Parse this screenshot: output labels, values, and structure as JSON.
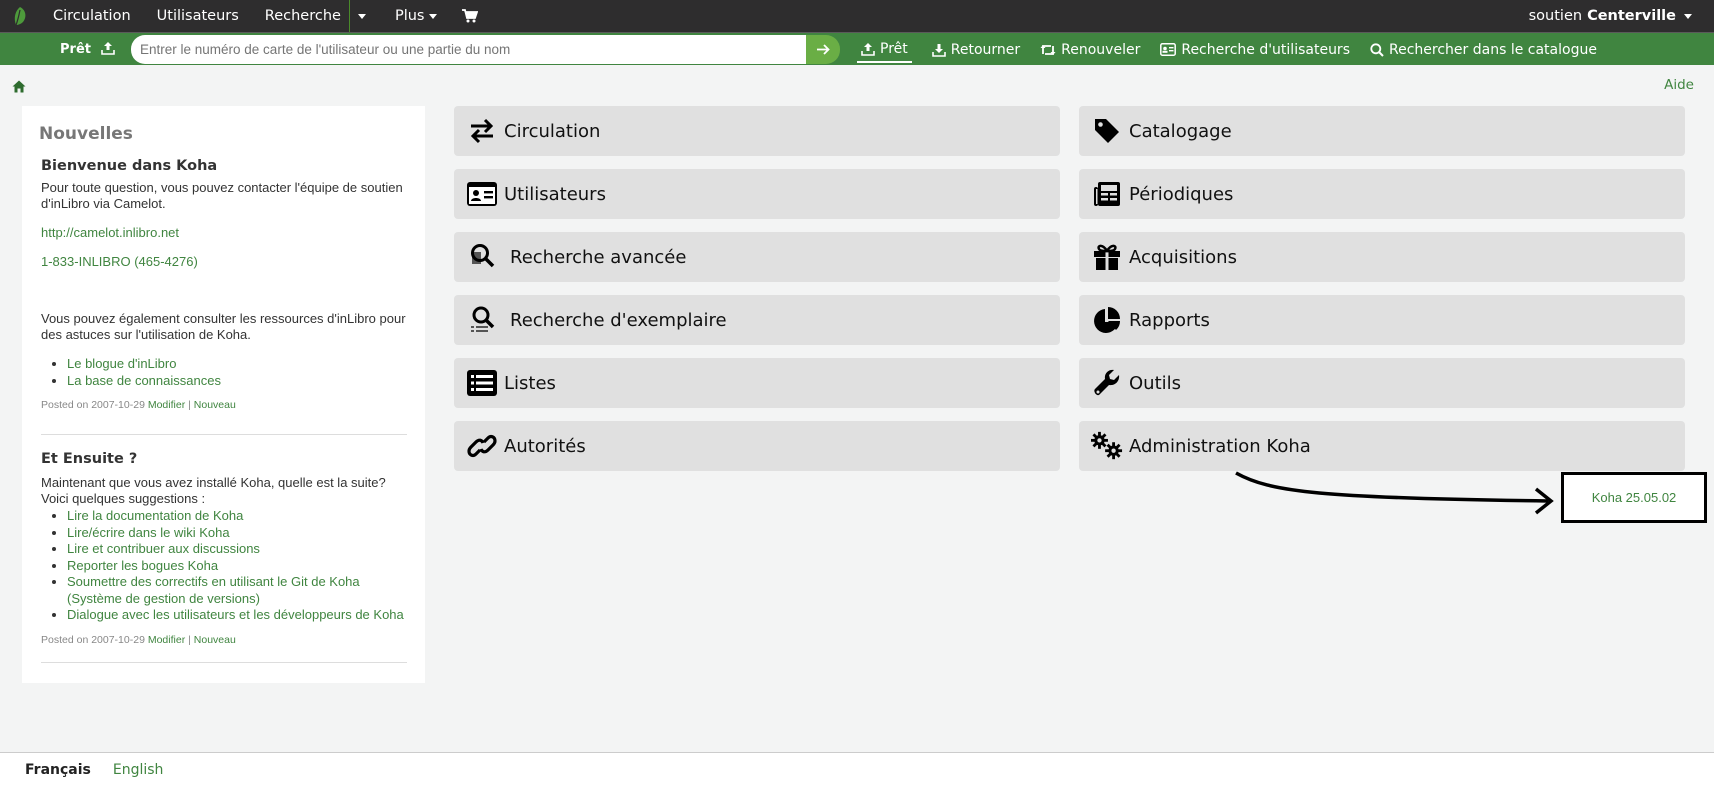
{
  "topnav": {
    "items": [
      "Circulation",
      "Utilisateurs",
      "Recherche",
      "Plus"
    ],
    "user_prefix": "soutien",
    "user_branch": "Centerville"
  },
  "searchbar": {
    "mode_label": "Prêt",
    "placeholder": "Entrer le numéro de carte de l'utilisateur ou une partie du nom",
    "links": [
      "Prêt",
      "Retourner",
      "Renouveler",
      "Recherche d'utilisateurs",
      "Rechercher dans le catalogue"
    ]
  },
  "help_label": "Aide",
  "news": {
    "heading": "Nouvelles",
    "items": [
      {
        "title": "Bienvenue dans Koha",
        "intro": "Pour toute question, vous pouvez contacter l'équipe de soutien d'inLibro via Camelot.",
        "url": "http://camelot.inlibro.net",
        "phone": "1-833-INLIBRO (465-4276)",
        "more": "Vous pouvez également consulter les ressources d'inLibro pour des astuces sur l'utilisation de Koha.",
        "links": [
          "Le blogue d'inLibro",
          "La base de connaissances"
        ],
        "posted": "Posted on 2007-10-29",
        "edit": "Modifier",
        "new": "Nouveau"
      },
      {
        "title": "Et Ensuite ?",
        "intro": "Maintenant que vous avez installé Koha, quelle est la suite? Voici quelques suggestions :",
        "links": [
          "Lire la documentation de Koha",
          "Lire/écrire dans le wiki Koha",
          "Lire et contribuer aux discussions",
          "Reporter les bogues Koha",
          "Soumettre des correctifs en utilisant le Git de Koha (Système de gestion de versions)",
          "Dialogue avec les utilisateurs et les développeurs de Koha"
        ],
        "posted": "Posted on 2007-10-29",
        "edit": "Modifier",
        "new": "Nouveau"
      }
    ]
  },
  "modules": {
    "left": [
      {
        "label": "Circulation",
        "icon": "exchange-icon"
      },
      {
        "label": "Utilisateurs",
        "icon": "id-card-icon"
      },
      {
        "label": "Recherche avancée",
        "icon": "search-book-icon"
      },
      {
        "label": "Recherche d'exemplaire",
        "icon": "search-list-icon"
      },
      {
        "label": "Listes",
        "icon": "list-icon"
      },
      {
        "label": "Autorités",
        "icon": "link-icon"
      }
    ],
    "right": [
      {
        "label": "Catalogage",
        "icon": "tag-icon"
      },
      {
        "label": "Périodiques",
        "icon": "newspaper-icon"
      },
      {
        "label": "Acquisitions",
        "icon": "gift-icon"
      },
      {
        "label": "Rapports",
        "icon": "pie-chart-icon"
      },
      {
        "label": "Outils",
        "icon": "wrench-icon"
      },
      {
        "label": "Administration Koha",
        "icon": "gears-icon"
      }
    ]
  },
  "version": "Koha 25.05.02",
  "footer": {
    "lang_active": "Français",
    "lang_other": "English"
  },
  "colors": {
    "brand_green": "#408540",
    "nav_dark": "#2e2d2e",
    "tile_bg": "#e0e0e0"
  }
}
